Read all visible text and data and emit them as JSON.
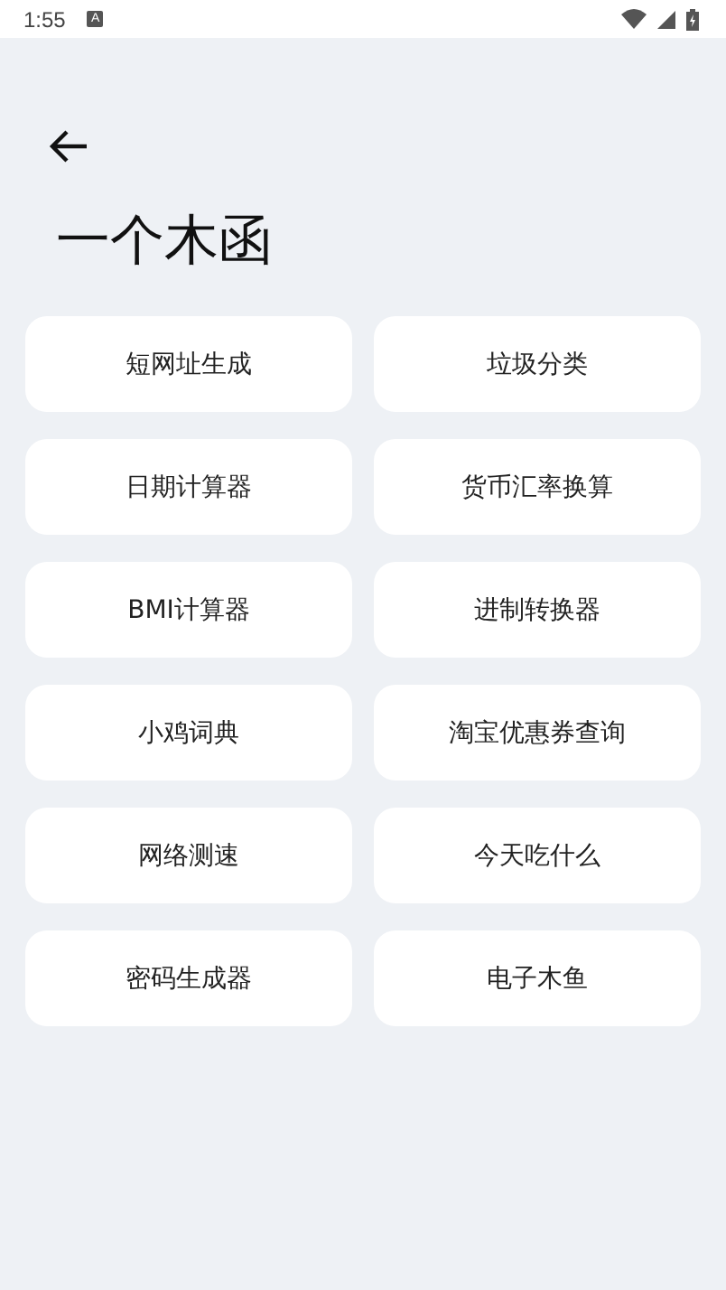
{
  "status_bar": {
    "time": "1:55",
    "notification": "A"
  },
  "title": "一个木函",
  "tools": [
    {
      "label": "短网址生成"
    },
    {
      "label": "垃圾分类"
    },
    {
      "label": "日期计算器"
    },
    {
      "label": "货币汇率换算"
    },
    {
      "label": "BMI计算器"
    },
    {
      "label": "进制转换器"
    },
    {
      "label": "小鸡词典"
    },
    {
      "label": "淘宝优惠券查询"
    },
    {
      "label": "网络测速"
    },
    {
      "label": "今天吃什么"
    },
    {
      "label": "密码生成器"
    },
    {
      "label": "电子木鱼"
    }
  ]
}
